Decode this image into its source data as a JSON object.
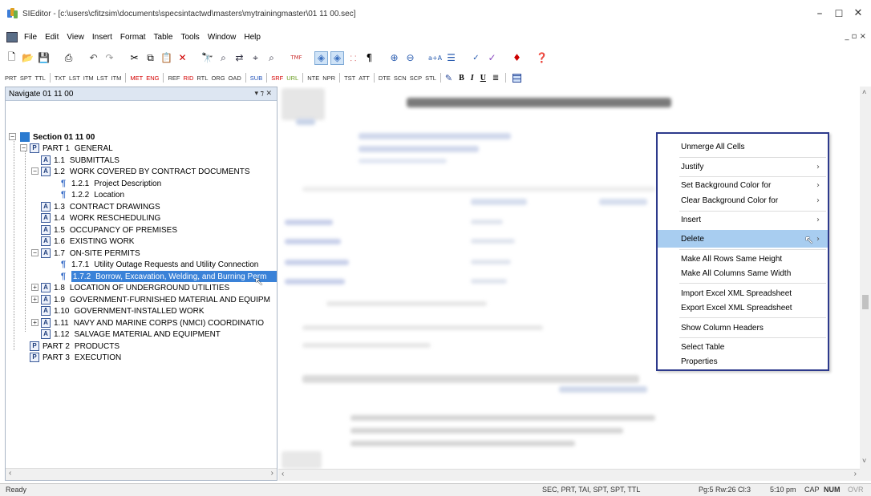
{
  "window": {
    "title": "SIEditor - [c:\\users\\cfitzsim\\documents\\specsintactwd\\masters\\mytrainingmaster\\01 11 00.sec]",
    "minimize": "–",
    "maximize": "☐",
    "close": "✕"
  },
  "menu": [
    "File",
    "Edit",
    "View",
    "Insert",
    "Format",
    "Table",
    "Tools",
    "Window",
    "Help"
  ],
  "mdi_controls": "_ ▫ ×",
  "toolbar2": [
    "PRT",
    "SPT",
    "TTL",
    "TXT",
    "LST",
    "ITM",
    "LST",
    "ITM",
    "MET",
    "ENG",
    "REF",
    "RID",
    "RTL",
    "ORG",
    "OAD",
    "SUB",
    "SRF",
    "URL",
    "NTE",
    "NPR",
    "TST",
    "ATT",
    "DTE",
    "SCN",
    "SCP",
    "STL",
    "B",
    "I",
    "U"
  ],
  "navigator": {
    "title": "Navigate 01 11 00",
    "controls": "▾ ⁊ ✕",
    "items": [
      {
        "num": "",
        "label": "Section 01 11 00"
      },
      {
        "num": "PART 1",
        "label": "GENERAL"
      },
      {
        "num": "1.1",
        "label": "SUBMITTALS"
      },
      {
        "num": "1.2",
        "label": "WORK COVERED BY CONTRACT DOCUMENTS"
      },
      {
        "num": "1.2.1",
        "label": "Project Description"
      },
      {
        "num": "1.2.2",
        "label": "Location"
      },
      {
        "num": "1.3",
        "label": "CONTRACT DRAWINGS"
      },
      {
        "num": "1.4",
        "label": "WORK RESCHEDULING"
      },
      {
        "num": "1.5",
        "label": "OCCUPANCY OF PREMISES"
      },
      {
        "num": "1.6",
        "label": "EXISTING WORK"
      },
      {
        "num": "1.7",
        "label": "ON-SITE PERMITS"
      },
      {
        "num": "1.7.1",
        "label": "Utility Outage Requests and Utility Connection"
      },
      {
        "num": "1.7.2",
        "label": "Borrow, Excavation, Welding, and Burning Perm"
      },
      {
        "num": "1.8",
        "label": "LOCATION OF UNDERGROUND UTILITIES"
      },
      {
        "num": "1.9",
        "label": "GOVERNMENT-FURNISHED MATERIAL AND EQUIPM"
      },
      {
        "num": "1.10",
        "label": "GOVERNMENT-INSTALLED WORK"
      },
      {
        "num": "1.11",
        "label": "NAVY AND MARINE CORPS (NMCI) COORDINATIO"
      },
      {
        "num": "1.12",
        "label": "SALVAGE MATERIAL AND EQUIPMENT"
      },
      {
        "num": "PART 2",
        "label": "PRODUCTS"
      },
      {
        "num": "PART 3",
        "label": "EXECUTION"
      }
    ]
  },
  "context_menu": {
    "items": [
      {
        "label": "Unmerge All Cells",
        "arrow": ""
      },
      {
        "label": "Justify",
        "arrow": "›"
      },
      {
        "label": "Set Background Color for",
        "arrow": "›"
      },
      {
        "label": "Clear Background Color for",
        "arrow": "›"
      },
      {
        "label": "Insert",
        "arrow": "›"
      },
      {
        "label": "Delete",
        "arrow": "›"
      },
      {
        "label": "Make All Rows Same Height",
        "arrow": ""
      },
      {
        "label": "Make All Columns Same Width",
        "arrow": ""
      },
      {
        "label": "Import Excel XML Spreadsheet",
        "arrow": ""
      },
      {
        "label": "Export Excel XML Spreadsheet",
        "arrow": ""
      },
      {
        "label": "Show Column Headers",
        "arrow": ""
      },
      {
        "label": "Select Table",
        "arrow": ""
      },
      {
        "label": "Properties",
        "arrow": ""
      }
    ]
  },
  "status": {
    "ready": "Ready",
    "tags": "SEC, PRT, TAI, SPT, SPT, TTL",
    "position": "Pg:5 Rw:26 Cl:3",
    "time": "5:10 pm",
    "cap": "CAP",
    "num": "NUM",
    "ovr": "OVR"
  },
  "colors": {
    "selection": "#3a82d8",
    "menu_highlight": "#a8cdf0",
    "menu_border": "#2d3a8c",
    "panel_header": "#dde6f2"
  }
}
